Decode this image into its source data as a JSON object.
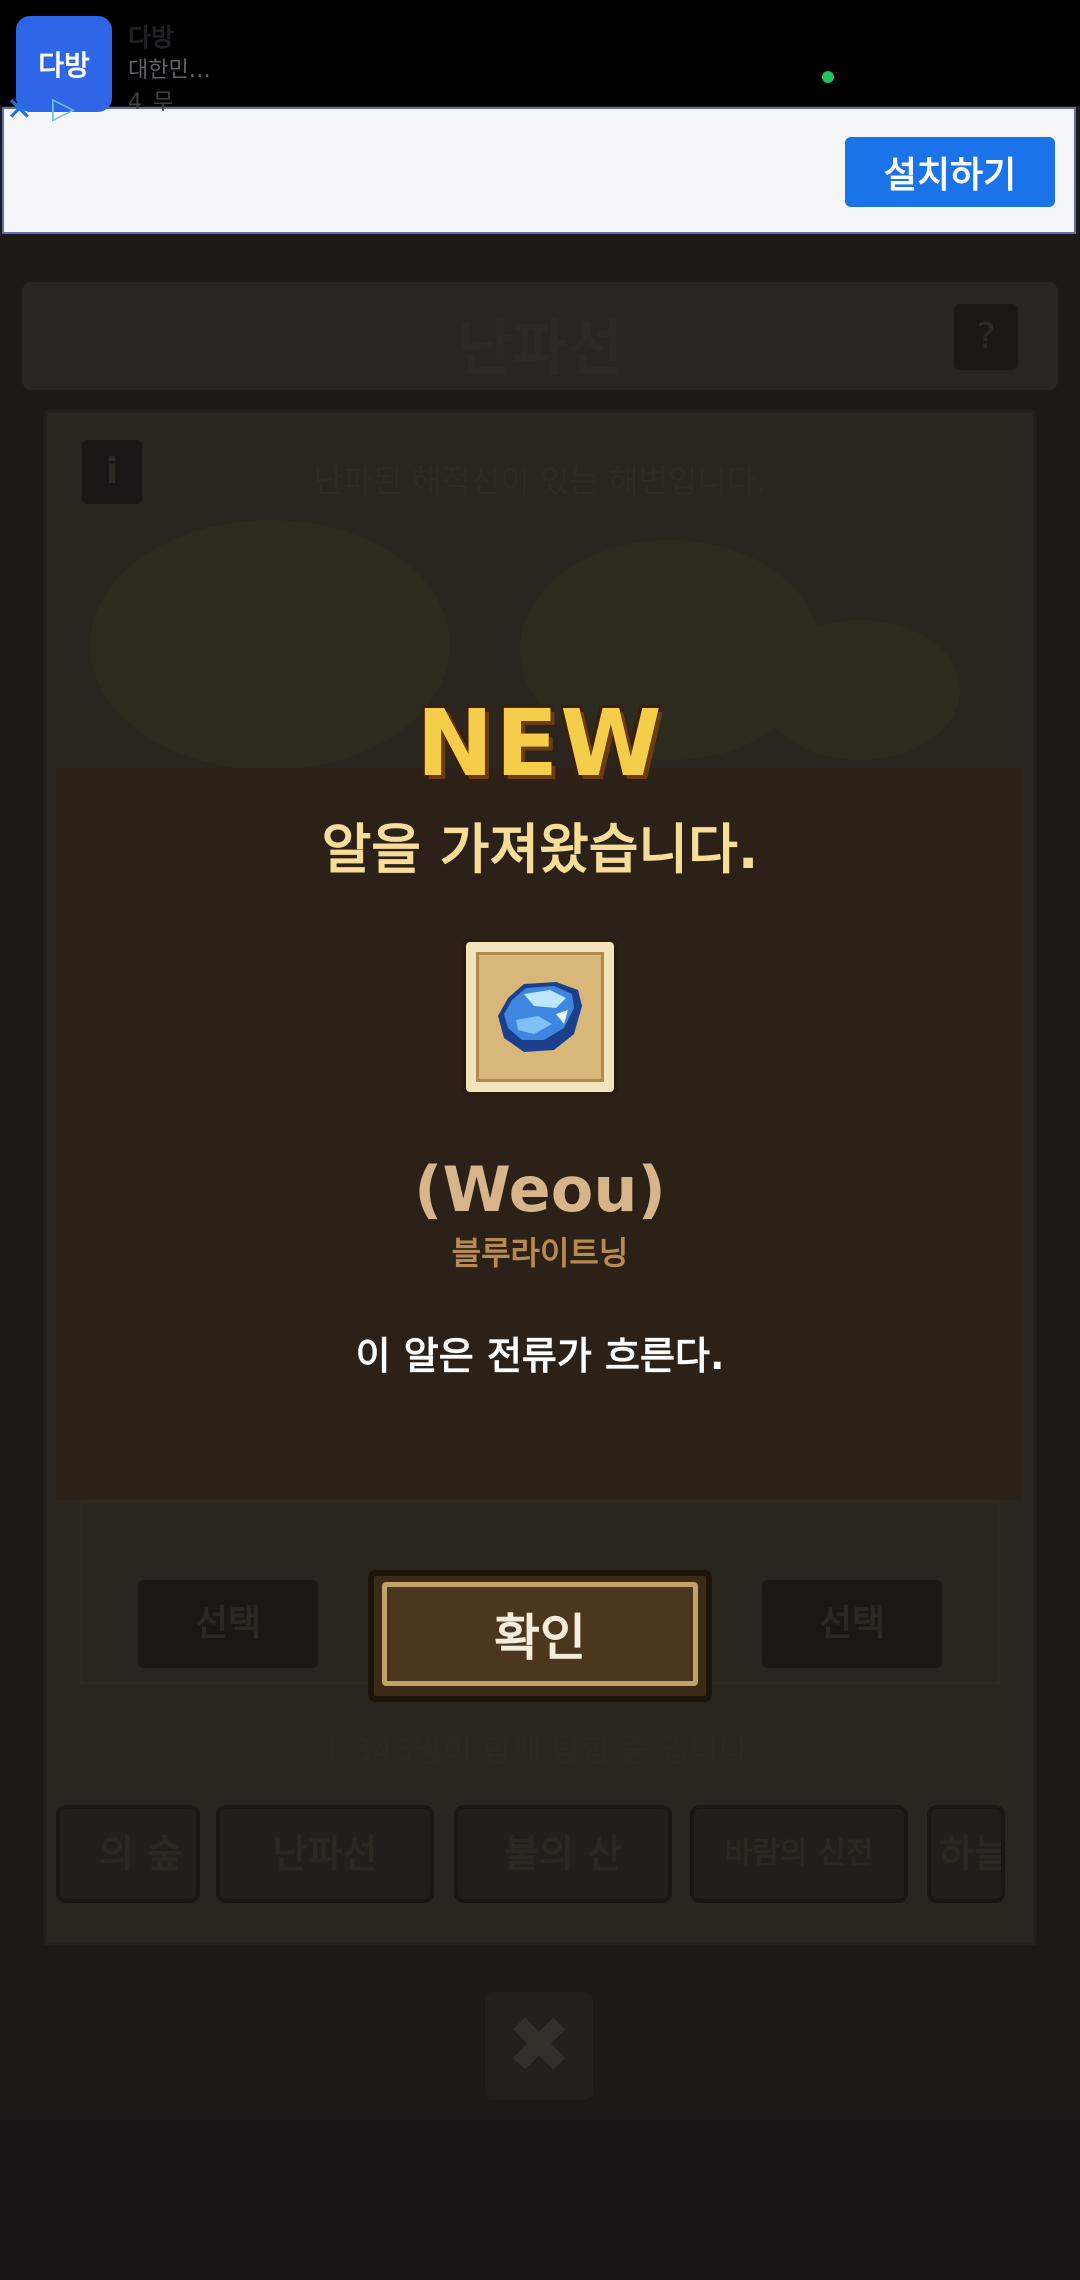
{
  "ad": {
    "app_name": "다방",
    "subtitle": "대한민…",
    "rating": "4   무",
    "install_label": "설치하기",
    "icon_text": "다방",
    "close_icon": "close-icon",
    "adchoices_icon": "play-triangle-icon"
  },
  "background": {
    "page_title": "난파선",
    "help_label": "?",
    "info_label": "i",
    "description": "난파된 해적선이 있는 해변입니다.",
    "select_left": "선택",
    "select_right": "선택",
    "players": "1,343명이 함께 탐험 중 입니다.",
    "tabs": [
      "의 숲",
      "난파선",
      "불의 산",
      "바람의 신전",
      "하늘"
    ],
    "close_label": "✖"
  },
  "modal": {
    "badge": "NEW",
    "heading": "알을 가져왔습니다.",
    "egg_name": "(Weou)",
    "egg_kind": "블루라이트닝",
    "egg_desc": "이 알은 전류가 흐른다.",
    "egg_icon": "blue-lightning-egg-icon"
  },
  "confirm": {
    "label": "확인"
  },
  "colors": {
    "accent_gold": "#f6cd4b",
    "heading": "#f7dd98",
    "install_blue": "#1a73e8"
  }
}
